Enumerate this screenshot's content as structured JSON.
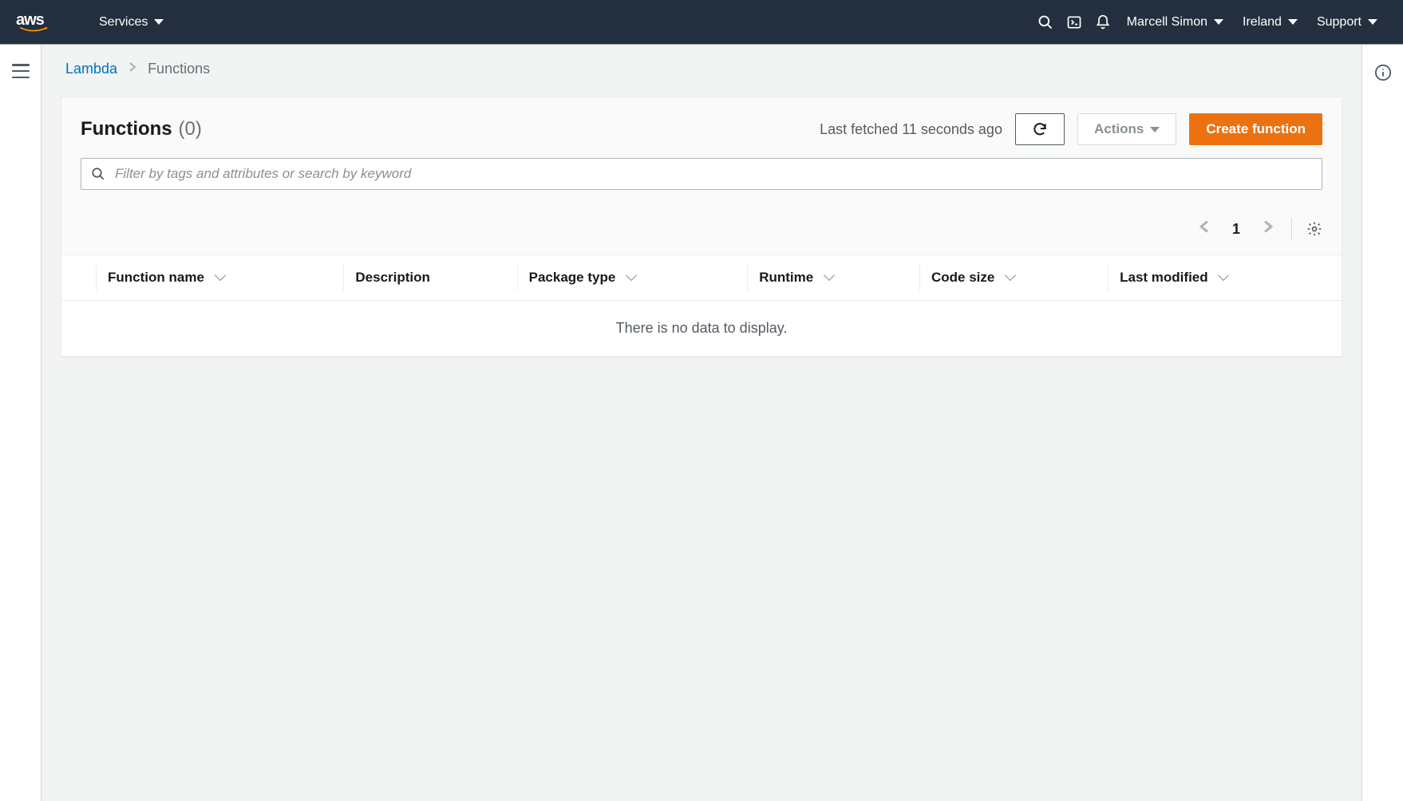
{
  "topnav": {
    "services_label": "Services",
    "username": "Marcell Simon",
    "region": "Ireland",
    "support_label": "Support"
  },
  "breadcrumb": {
    "service": "Lambda",
    "current": "Functions"
  },
  "panel": {
    "title": "Functions",
    "count_display": "(0)",
    "last_fetched": "Last fetched 11 seconds ago",
    "actions_label": "Actions",
    "create_label": "Create function"
  },
  "search": {
    "placeholder": "Filter by tags and attributes or search by keyword"
  },
  "pagination": {
    "current_page": "1"
  },
  "table": {
    "columns": {
      "function_name": "Function name",
      "description": "Description",
      "package_type": "Package type",
      "runtime": "Runtime",
      "code_size": "Code size",
      "last_modified": "Last modified"
    },
    "empty_message": "There is no data to display."
  }
}
